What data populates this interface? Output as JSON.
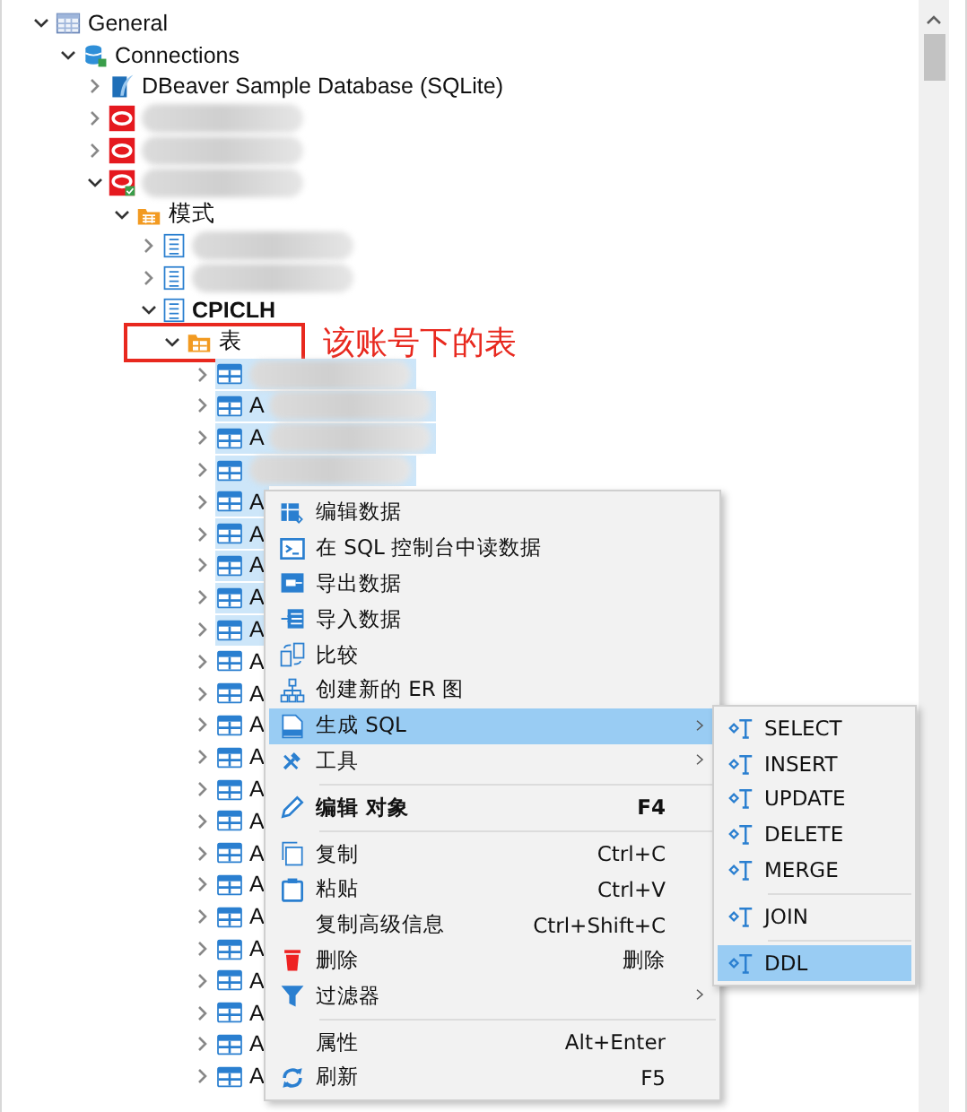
{
  "tree": [
    {
      "label": "General",
      "kind": "general",
      "expanded": true,
      "children": [
        {
          "label": "Connections",
          "kind": "connections",
          "expanded": true,
          "children": [
            {
              "label": "DBeaver Sample Database (SQLite)",
              "kind": "sqlite",
              "expanded": false
            },
            {
              "kind": "oracle",
              "redacted": true,
              "expanded": false
            },
            {
              "kind": "oracle",
              "redacted": true,
              "expanded": false
            },
            {
              "kind": "oracle-connected",
              "redacted": true,
              "expanded": true,
              "children": [
                {
                  "label": "模式",
                  "kind": "schemas",
                  "expanded": true,
                  "children": [
                    {
                      "kind": "schema",
                      "redacted": true,
                      "expanded": false
                    },
                    {
                      "kind": "schema",
                      "redacted": true,
                      "expanded": false
                    },
                    {
                      "label": "CPICLH",
                      "kind": "schema",
                      "bold": true,
                      "expanded": true,
                      "children": [
                        {
                          "label": "表",
                          "kind": "tables",
                          "expanded": true,
                          "boxed": true,
                          "annotation": "该账号下的表",
                          "children": [
                            {
                              "kind": "table",
                              "redacted": true,
                              "expanded": false,
                              "selected": true
                            },
                            {
                              "label": "A",
                              "kind": "table",
                              "redacted": true,
                              "expanded": false,
                              "selected": true
                            },
                            {
                              "label": "A",
                              "kind": "table",
                              "redacted": true,
                              "expanded": false,
                              "selected": true
                            },
                            {
                              "kind": "table",
                              "redacted": true,
                              "expanded": false,
                              "selected": true
                            },
                            {
                              "label": "A",
                              "kind": "table",
                              "expanded": false,
                              "selected": true
                            },
                            {
                              "label": "A",
                              "kind": "table",
                              "expanded": false,
                              "selected": true
                            },
                            {
                              "label": "A",
                              "kind": "table",
                              "expanded": false,
                              "selected": true
                            },
                            {
                              "label": "A",
                              "kind": "table",
                              "expanded": false,
                              "selected": true
                            },
                            {
                              "label": "A",
                              "kind": "table",
                              "expanded": false,
                              "selected": true
                            },
                            {
                              "label": "A",
                              "kind": "table",
                              "expanded": false,
                              "selected": false
                            },
                            {
                              "label": "A",
                              "kind": "table",
                              "expanded": false,
                              "selected": false
                            },
                            {
                              "label": "A",
                              "kind": "table",
                              "expanded": false,
                              "selected": false
                            },
                            {
                              "label": "A",
                              "kind": "table",
                              "expanded": false,
                              "selected": false
                            },
                            {
                              "label": "A",
                              "kind": "table",
                              "expanded": false,
                              "selected": false
                            },
                            {
                              "label": "A",
                              "kind": "table",
                              "expanded": false,
                              "selected": false
                            },
                            {
                              "label": "A",
                              "kind": "table",
                              "expanded": false,
                              "selected": false
                            },
                            {
                              "label": "A",
                              "kind": "table",
                              "expanded": false,
                              "selected": false
                            },
                            {
                              "label": "A",
                              "kind": "table",
                              "expanded": false,
                              "selected": false
                            },
                            {
                              "label": "A",
                              "kind": "table",
                              "expanded": false,
                              "selected": false
                            },
                            {
                              "label": "A",
                              "kind": "table",
                              "expanded": false,
                              "selected": false
                            },
                            {
                              "label": "A",
                              "kind": "table",
                              "expanded": false,
                              "selected": false
                            },
                            {
                              "label": "A",
                              "kind": "table",
                              "expanded": false,
                              "selected": false
                            },
                            {
                              "label": "A",
                              "kind": "table",
                              "expanded": false,
                              "selected": false
                            }
                          ]
                        }
                      ]
                    }
                  ]
                }
              ]
            }
          ]
        }
      ]
    }
  ],
  "context_menu": {
    "groups": [
      [
        {
          "label": "编辑数据",
          "selected": false
        },
        {
          "label": "在 SQL 控制台中读数据",
          "selected": false
        },
        {
          "label": "导出数据",
          "selected": false
        },
        {
          "label": "导入数据",
          "selected": false
        },
        {
          "label": "比较",
          "selected": false
        },
        {
          "label": "创建新的 ER 图",
          "selected": false
        },
        {
          "label": "生成 SQL",
          "submenu": true,
          "selected": true
        },
        {
          "label": "工具",
          "submenu": true,
          "selected": false
        }
      ],
      [
        {
          "label": "编辑 对象",
          "shortcut": "F4",
          "bold": true,
          "selected": false
        }
      ],
      [
        {
          "label": "复制",
          "shortcut": "Ctrl+C",
          "selected": false
        },
        {
          "label": "粘贴",
          "shortcut": "Ctrl+V",
          "selected": false
        },
        {
          "label": "复制高级信息",
          "shortcut": "Ctrl+Shift+C",
          "selected": false
        },
        {
          "label": "删除",
          "shortcut": "删除",
          "selected": false
        },
        {
          "label": "过滤器",
          "submenu": true,
          "selected": false
        }
      ],
      [
        {
          "label": "属性",
          "shortcut": "Alt+Enter",
          "selected": false
        },
        {
          "label": "刷新",
          "shortcut": "F5",
          "selected": false
        }
      ]
    ]
  },
  "submenu": {
    "groups": [
      [
        {
          "label": "SELECT",
          "selected": false
        },
        {
          "label": "INSERT",
          "selected": false
        },
        {
          "label": "UPDATE",
          "selected": false
        },
        {
          "label": "DELETE",
          "selected": false
        },
        {
          "label": "MERGE",
          "selected": false
        }
      ],
      [
        {
          "label": "JOIN",
          "selected": false
        }
      ],
      [
        {
          "label": "DDL",
          "selected": true
        }
      ]
    ]
  }
}
